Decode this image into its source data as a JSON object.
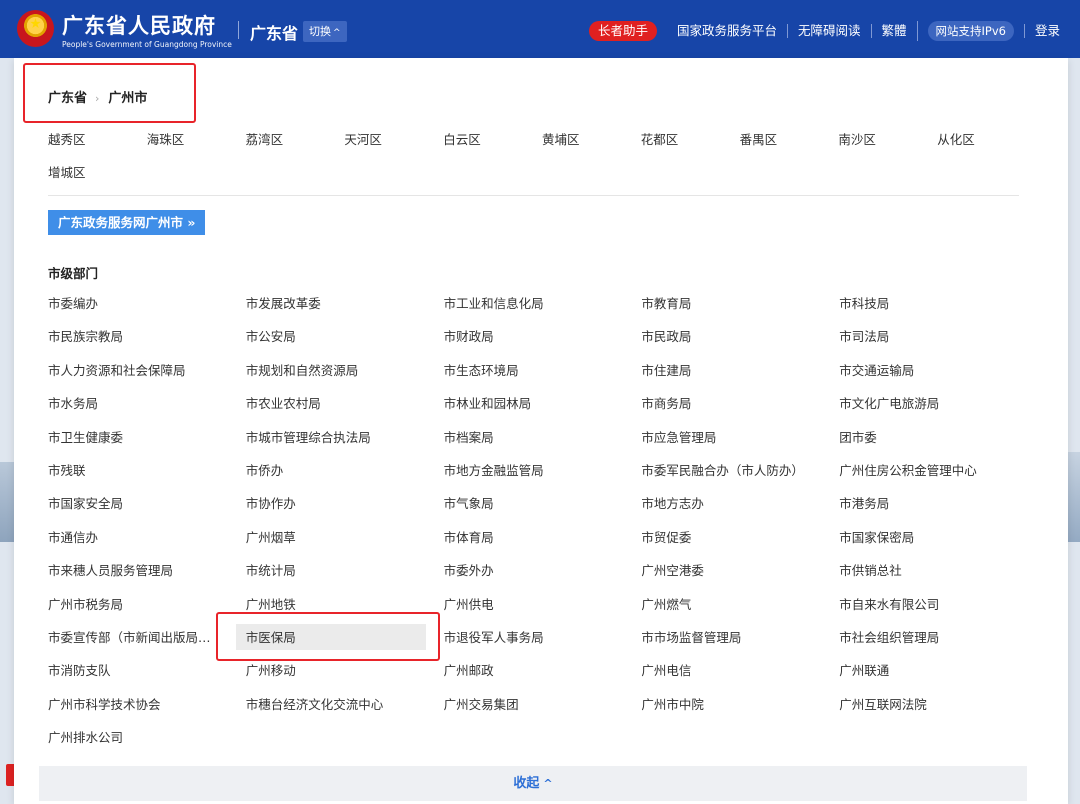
{
  "header": {
    "title": "广东省人民政府",
    "subtitle": "People's Government of Guangdong Province",
    "province": "广东省",
    "switch_label": "切换",
    "switch_icon": "chevron-up-icon",
    "nav": {
      "elder": "长者助手",
      "gov_platform": "国家政务服务平台",
      "accessible": "无障碍阅读",
      "traditional": "繁體",
      "ipv6": "网站支持IPv6",
      "login": "登录"
    },
    "colors": {
      "header_bg": "#1745a8",
      "elder_pill": "#e02020"
    }
  },
  "breadcrumb": {
    "level1": "广东省",
    "separator": "›",
    "level2": "广州市"
  },
  "districts": [
    "越秀区",
    "海珠区",
    "荔湾区",
    "天河区",
    "白云区",
    "黄埔区",
    "花都区",
    "番禺区",
    "南沙区",
    "从化区",
    "增城区"
  ],
  "portal_button": "广东政务服务网广州市 »",
  "section_title": "市级部门",
  "departments": [
    "市委编办",
    "市发展改革委",
    "市工业和信息化局",
    "市教育局",
    "市科技局",
    "市民族宗教局",
    "市公安局",
    "市财政局",
    "市民政局",
    "市司法局",
    "市人力资源和社会保障局",
    "市规划和自然资源局",
    "市生态环境局",
    "市住建局",
    "市交通运输局",
    "市水务局",
    "市农业农村局",
    "市林业和园林局",
    "市商务局",
    "市文化广电旅游局",
    "市卫生健康委",
    "市城市管理综合执法局",
    "市档案局",
    "市应急管理局",
    "团市委",
    "市残联",
    "市侨办",
    "市地方金融监管局",
    "市委军民融合办（市人防办）",
    "广州住房公积金管理中心",
    "市国家安全局",
    "市协作办",
    "市气象局",
    "市地方志办",
    "市港务局",
    "市通信办",
    "广州烟草",
    "市体育局",
    "市贸促委",
    "市国家保密局",
    "市来穗人员服务管理局",
    "市统计局",
    "市委外办",
    "广州空港委",
    "市供销总社",
    "广州市税务局",
    "广州地铁",
    "广州供电",
    "广州燃气",
    "市自来水有限公司",
    "市委宣传部（市新闻出版局…",
    "市医保局",
    "市退役军人事务局",
    "市市场监督管理局",
    "市社会组织管理局",
    "市消防支队",
    "广州移动",
    "广州邮政",
    "广州电信",
    "广州联通",
    "广州市科学技术协会",
    "市穗台经济文化交流中心",
    "广州交易集团",
    "广州市中院",
    "广州互联网法院",
    "广州排水公司"
  ],
  "highlighted_department": "市医保局",
  "collapse_label": "收起",
  "collapse_icon": "chevron-up-icon",
  "accent_color": "#3f8ee8",
  "annotation_color": "#e8242a"
}
